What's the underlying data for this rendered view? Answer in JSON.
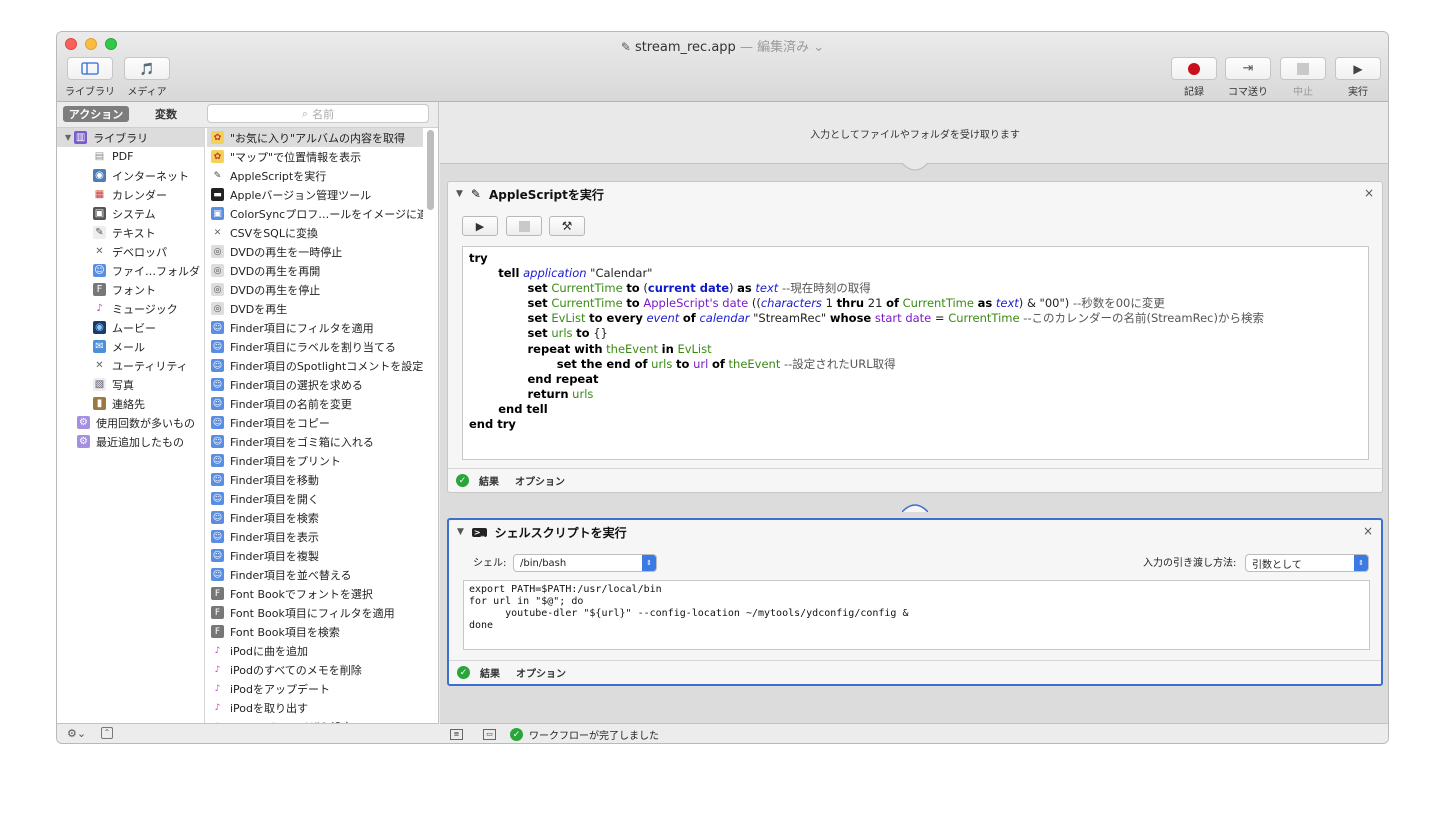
{
  "window": {
    "title": "stream_rec.app",
    "edited": "— 編集済み ⌄"
  },
  "toolbar": {
    "library_label": "ライブラリ",
    "media_label": "メディア",
    "record_label": "記録",
    "step_label": "コマ送り",
    "stop_label": "中止",
    "run_label": "実行"
  },
  "left_pane": {
    "tab_actions": "アクション",
    "tab_variables": "変数",
    "search_placeholder": "名前",
    "library": [
      {
        "label": "ライブラリ",
        "icon": "books-icon"
      },
      {
        "label": "PDF",
        "icon": "pdf-icon"
      },
      {
        "label": "インターネット",
        "icon": "globe-icon"
      },
      {
        "label": "カレンダー",
        "icon": "calendar-icon"
      },
      {
        "label": "システム",
        "icon": "system-icon"
      },
      {
        "label": "テキスト",
        "icon": "text-icon"
      },
      {
        "label": "デベロッパ",
        "icon": "developer-icon"
      },
      {
        "label": "ファイ…フォルダ",
        "icon": "finder-icon"
      },
      {
        "label": "フォント",
        "icon": "font-icon"
      },
      {
        "label": "ミュージック",
        "icon": "music-icon"
      },
      {
        "label": "ムービー",
        "icon": "movie-icon"
      },
      {
        "label": "メール",
        "icon": "mail-icon"
      },
      {
        "label": "ユーティリティ",
        "icon": "utility-icon"
      },
      {
        "label": "写真",
        "icon": "photo-icon"
      },
      {
        "label": "連絡先",
        "icon": "contacts-icon"
      },
      {
        "label": "使用回数が多いもの",
        "icon": "smart-folder-icon"
      },
      {
        "label": "最近追加したもの",
        "icon": "smart-folder-icon"
      }
    ],
    "actions": [
      "\"お気に入り\"アルバムの内容を取得",
      "\"マップ\"で位置情報を表示",
      "AppleScriptを実行",
      "Appleバージョン管理ツール",
      "ColorSyncプロフ…ールをイメージに適用",
      "CSVをSQLに変換",
      "DVDの再生を一時停止",
      "DVDの再生を再開",
      "DVDの再生を停止",
      "DVDを再生",
      "Finder項目にフィルタを適用",
      "Finder項目にラベルを割り当てる",
      "Finder項目のSpotlightコメントを設定",
      "Finder項目の選択を求める",
      "Finder項目の名前を変更",
      "Finder項目をコピー",
      "Finder項目をゴミ箱に入れる",
      "Finder項目をプリント",
      "Finder項目を移動",
      "Finder項目を開く",
      "Finder項目を検索",
      "Finder項目を表示",
      "Finder項目を複製",
      "Finder項目を並べ替える",
      "Font Bookでフォントを選択",
      "Font Book項目にフィルタを適用",
      "Font Book項目を検索",
      "iPodに曲を追加",
      "iPodのすべてのメモを削除",
      "iPodをアップデート",
      "iPodを取り出す",
      "iTunesイコライザを設定"
    ]
  },
  "workflow": {
    "input_note": "入力としてファイルやフォルダを受け取ります",
    "applescript_action": {
      "title": "AppleScriptを実行",
      "footer_results": "結果",
      "footer_options": "オプション"
    },
    "shell_action": {
      "title": "シェルスクリプトを実行",
      "shell_label": "シェル:",
      "shell_value": "/bin/bash",
      "pass_input_label": "入力の引き渡し方法:",
      "pass_input_value": "引数として",
      "code": "export PATH=$PATH:/usr/local/bin\nfor url in \"$@\"; do\n      youtube-dler \"${url}\" --config-location ~/mytools/ydconfig/config &\ndone",
      "footer_results": "結果",
      "footer_options": "オプション"
    },
    "status": "ワークフローが完了しました"
  },
  "colors": {
    "record_red": "#c8101e",
    "selection_blue": "#3b6fd0",
    "variable_green": "#3a8b14",
    "class_blue": "#1a1ad0",
    "property_purple": "#7a1ac8"
  }
}
